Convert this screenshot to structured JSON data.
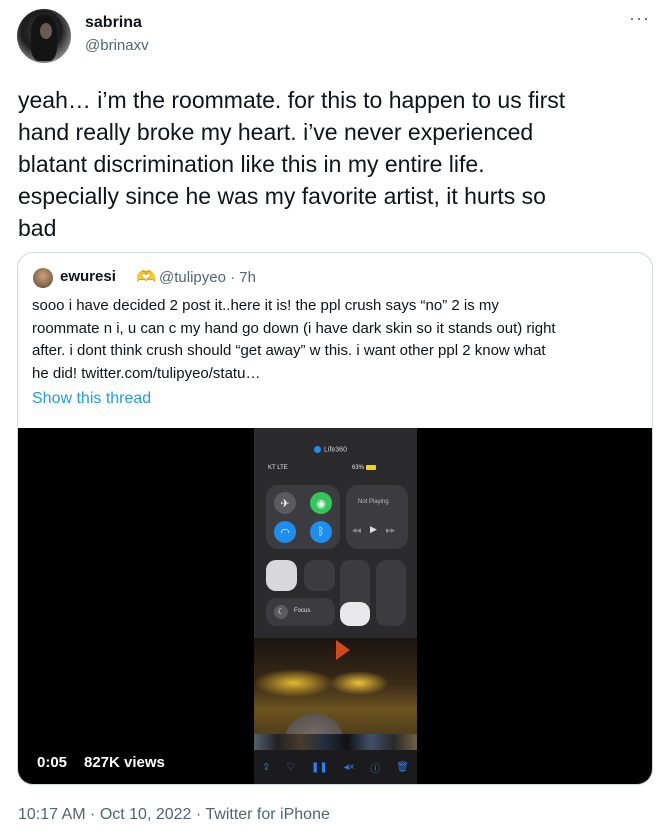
{
  "author": {
    "display_name": "sabrina",
    "handle": "@brinaxv"
  },
  "more_icon": "more-horizontal-icon",
  "tweet": {
    "text": "yeah… i’m the roommate. for this to happen to us first\nhand really broke my heart. i’ve never experienced\nblatant discrimination like this in my entire life.\nespecially since he was my favorite artist, it hurts so\nbad"
  },
  "quote": {
    "display_name": "ewuresi",
    "emoji": "🫶",
    "handle_time": "@tulipyeo · 7h",
    "text": "sooo i have decided 2 post it..here it is! the ppl crush says “no” 2 is my\nroommate n i, u can c my hand go down (i have dark skin so it stands out) right\nafter. i dont think crush should “get away” w this. i want other ppl 2 know what\nhe did!  twitter.com/tulipyeo/statu…",
    "show_thread": "Show this thread",
    "video": {
      "elapsed": "0:05",
      "views": "827K views",
      "screen": {
        "pill_label": "Life360",
        "carrier": "KT LTE",
        "battery": "63%",
        "now_playing": "Not Playing",
        "focus_label": "Focus"
      }
    }
  },
  "meta": "10:17 AM · Oct 10, 2022 · Twitter for iPhone",
  "colors": {
    "link": "#1d9bf0",
    "secondary_text": "#536471",
    "border": "#cfd9de"
  }
}
